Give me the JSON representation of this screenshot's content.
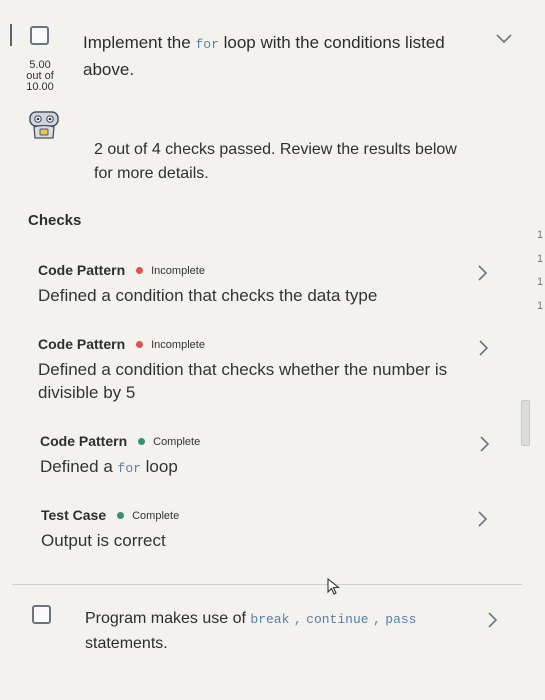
{
  "task1": {
    "title_pre": "Implement the",
    "title_code": "for",
    "title_post": " loop with the conditions listed above.",
    "score_value": "5.00",
    "score_outof": "out of",
    "score_max": "10.00"
  },
  "summary": "2 out of 4 checks passed. Review the results below for more details.",
  "checks_heading": "Checks",
  "checks": [
    {
      "type": "Code Pattern",
      "status": "Incomplete",
      "status_color": "#d9534f",
      "desc": "Defined a condition that checks the data type"
    },
    {
      "type": "Code Pattern",
      "status": "Incomplete",
      "status_color": "#d9534f",
      "desc": "Defined a condition that checks whether the number is divisible by 5"
    },
    {
      "type": "Code Pattern",
      "status": "Complete",
      "status_color": "#3e8e6b",
      "desc_pre": "Defined a",
      "desc_code": "for",
      "desc_post": "loop"
    },
    {
      "type": "Test Case",
      "status": "Complete",
      "status_color": "#3e8e6b",
      "desc": "Output is correct"
    }
  ],
  "task2": {
    "title_pre": "Program makes use of",
    "code1": "break",
    "sep1": ",",
    "code2": "continue",
    "sep2": ",",
    "code3": "pass",
    "title_post": "statements."
  },
  "side_numbers": [
    "1",
    "1",
    "1",
    "1"
  ],
  "icons": {
    "expand": "chevron-down-icon",
    "row": "chevron-right-icon",
    "avatar": "robot-icon",
    "cursor": "mouse-pointer-icon"
  },
  "colors": {
    "incomplete": "#d9534f",
    "complete": "#3e8e6b",
    "code": "#5b7fa6"
  }
}
